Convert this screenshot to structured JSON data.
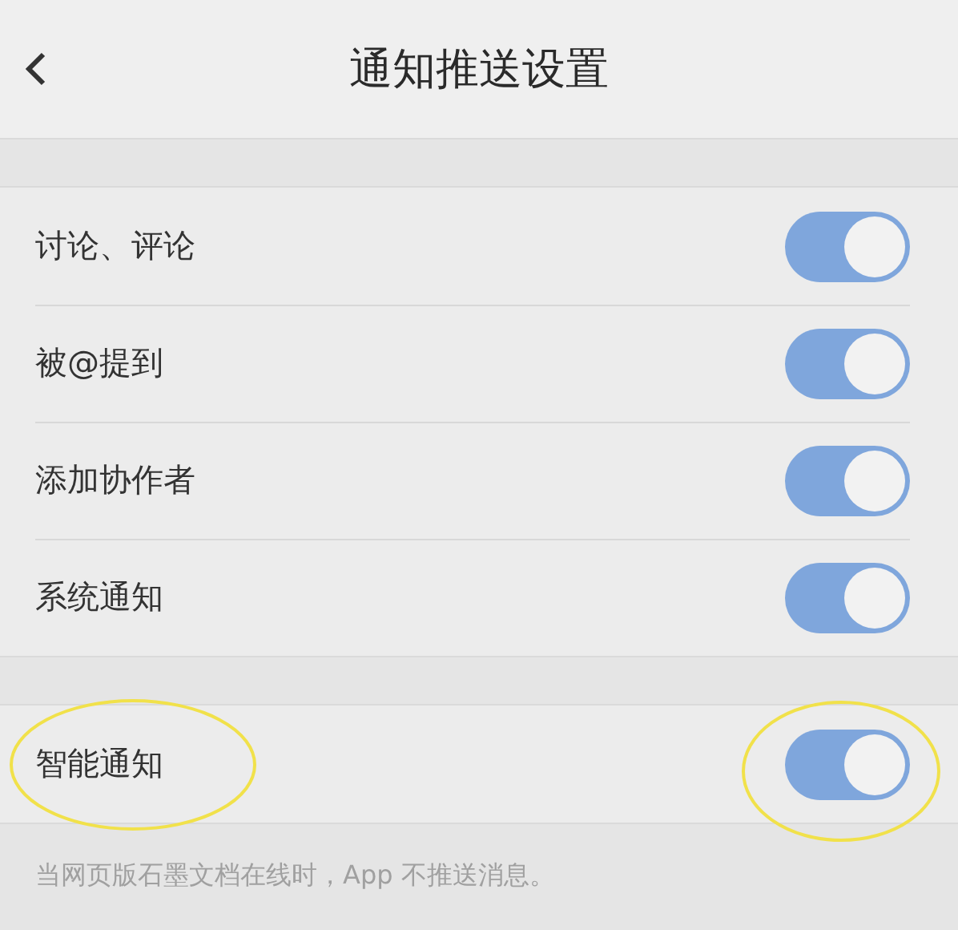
{
  "header": {
    "title": "通知推送设置"
  },
  "sections": [
    {
      "items": [
        {
          "label": "讨论、评论",
          "on": true,
          "circled": false
        },
        {
          "label": "被@提到",
          "on": true,
          "circled": false
        },
        {
          "label": "添加协作者",
          "on": true,
          "circled": false
        },
        {
          "label": "系统通知",
          "on": true,
          "circled": false
        }
      ]
    },
    {
      "items": [
        {
          "label": "智能通知",
          "on": true,
          "circled": true
        }
      ]
    }
  ],
  "footer_note": "当网页版石墨文档在线时，App 不推送消息。"
}
